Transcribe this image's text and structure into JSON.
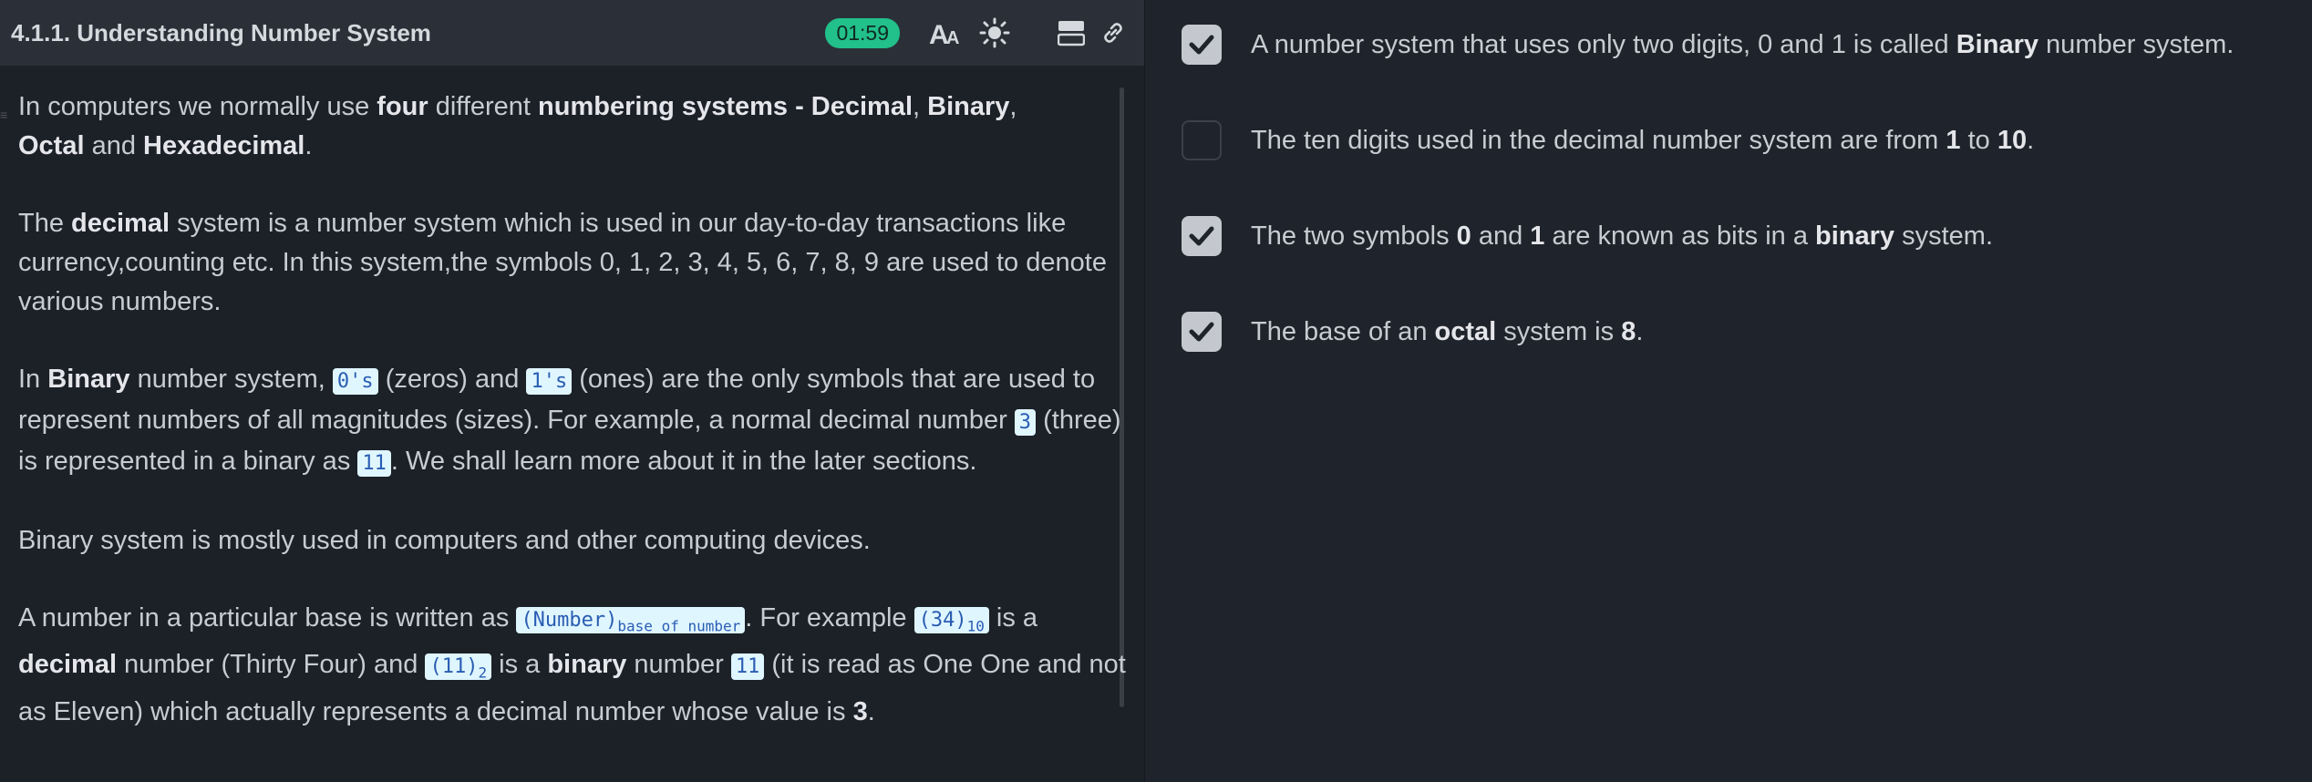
{
  "header": {
    "title": "4.1.1. Understanding Number System",
    "timer": "01:59",
    "icons": [
      "font-size-icon",
      "brightness-icon",
      "layout-icon",
      "link-icon"
    ]
  },
  "content": {
    "p1": {
      "t1": "In computers we normally use ",
      "b1": "four",
      "t2": " different ",
      "b2": "numbering systems - Decimal",
      "t3": ", ",
      "b3": "Binary",
      "t4": ", ",
      "b4": "Octal",
      "t5": " and ",
      "b5": "Hexadecimal",
      "t6": "."
    },
    "p2": {
      "t1": "The ",
      "b1": "decimal",
      "t2": " system is a number system which is used in our day-to-day transactions like currency,counting etc. In this system,the symbols 0, 1, 2, 3, 4, 5, 6, 7, 8, 9 are used to denote various numbers."
    },
    "p3": {
      "t1": "In ",
      "b1": "Binary",
      "t2": " number system, ",
      "c1": "0's",
      "t3": " (zeros) and ",
      "c2": "1's",
      "t4": " (ones) are the only symbols that are used to represent numbers of all magnitudes (sizes). For example, a normal decimal number ",
      "c3": "3",
      "t5": " (three) is represented in a binary as ",
      "c4": "11",
      "t6": ". We shall learn more about it in the later sections."
    },
    "p4": "Binary system is mostly used in computers and other computing devices.",
    "p5": {
      "t1": "A number in a particular base is written as ",
      "c1": "(Number)",
      "c1sub": "base of number",
      "t2": ". For example ",
      "c2": "(34)",
      "c2sub": "10",
      "t3": " is a ",
      "b1": "decimal",
      "t4": " number (Thirty Four) and ",
      "c3": "(11)",
      "c3sub": "2",
      "t5": " is a ",
      "b2": "binary",
      "t6": " number ",
      "c4": "11",
      "t7": " (it is read as One One and not as Eleven) which actually represents a decimal number whose value is ",
      "b3": "3",
      "t8": "."
    }
  },
  "checklist": [
    {
      "checked": true,
      "t1": "A number system that uses only two digits, 0 and 1 is called ",
      "b1": "Binary",
      "t2": " number system."
    },
    {
      "checked": false,
      "t1": "The ten digits used in the decimal number system are from ",
      "b1": "1",
      "t2": " to ",
      "b2": "10",
      "t3": "."
    },
    {
      "checked": true,
      "t1": "The two symbols ",
      "b1": "0",
      "t2": " and ",
      "b2": "1",
      "t3": " are known as bits in a ",
      "b3": "binary",
      "t4": " system."
    },
    {
      "checked": true,
      "t1": "The base of an ",
      "b1": "octal",
      "t2": " system is ",
      "b2": "8",
      "t3": "."
    }
  ]
}
